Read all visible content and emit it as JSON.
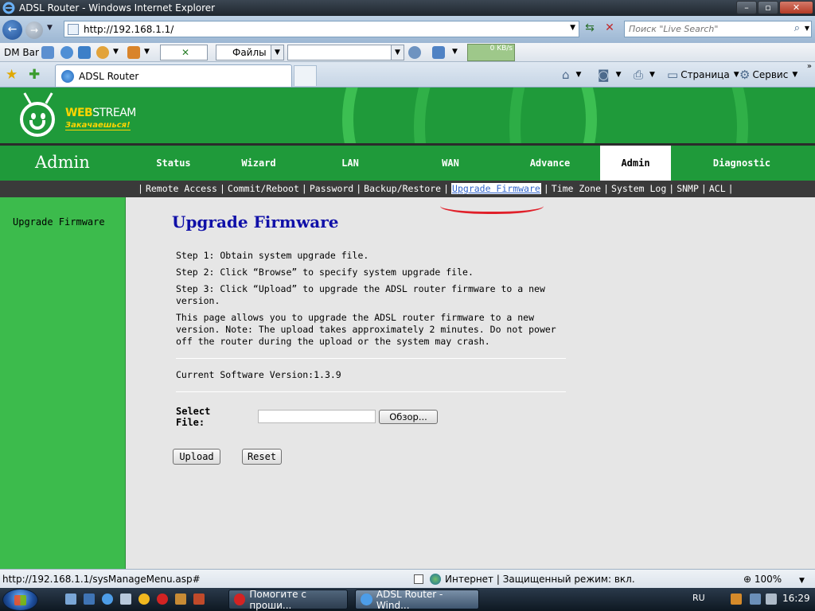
{
  "window": {
    "title": "ADSL Router - Windows Internet Explorer"
  },
  "address_bar": {
    "url": "http://192.168.1.1/",
    "search_placeholder": "Поиск \"Live Search\""
  },
  "dm_bar": {
    "label": "DM Bar",
    "files_label": "Файлы",
    "speed": "0 KB/s"
  },
  "tab": {
    "label": "ADSL Router"
  },
  "tools": {
    "page_label": "Страница",
    "service_label": "Сервис"
  },
  "router": {
    "logo_web": "WEB",
    "logo_stream": "STREAM",
    "logo_slogan": "Закачаешься!",
    "section_title": "Admin",
    "main_tabs": [
      {
        "label": "Status"
      },
      {
        "label": "Wizard"
      },
      {
        "label": "LAN"
      },
      {
        "label": "WAN"
      },
      {
        "label": "Advance"
      },
      {
        "label": "Admin"
      },
      {
        "label": "Diagnostic"
      }
    ],
    "sub_tabs": [
      {
        "label": "Remote Access"
      },
      {
        "label": "Commit/Reboot"
      },
      {
        "label": "Password"
      },
      {
        "label": "Backup/Restore"
      },
      {
        "label": "Upgrade Firmware"
      },
      {
        "label": "Time Zone"
      },
      {
        "label": "System Log"
      },
      {
        "label": "SNMP"
      },
      {
        "label": "ACL"
      }
    ],
    "sidebar_item": "Upgrade Firmware",
    "page_title": "Upgrade Firmware",
    "step1": "Step 1: Obtain system upgrade file.",
    "step2": "Step 2: Click “Browse” to specify system upgrade file.",
    "step3": "Step 3: Click “Upload” to upgrade the ADSL router firmware to a new version.",
    "description": "This page allows you to upgrade the ADSL router firmware to a new version. Note: The upload takes approximately 2 minutes. Do not power off the router during the upload or the system may crash.",
    "current_version_label": "Current Software Version:",
    "current_version": "1.3.9",
    "select_file_label": "Select File:",
    "browse_label": "Обзор...",
    "upload_label": "Upload",
    "reset_label": "Reset"
  },
  "status_bar": {
    "url": "http://192.168.1.1/sysManageMenu.asp#",
    "zone": "Интернет | Защищенный режим: вкл.",
    "zoom": "100%"
  },
  "taskbar": {
    "task1": "Помогите с проши...",
    "task2": "ADSL Router - Wind...",
    "lang": "RU",
    "time": "16:29"
  },
  "colors": {
    "router_green": "#1f9a3a",
    "sidebar_green": "#3cbb4c",
    "title_blue": "#1010a8",
    "annotation_red": "#e0202a"
  }
}
